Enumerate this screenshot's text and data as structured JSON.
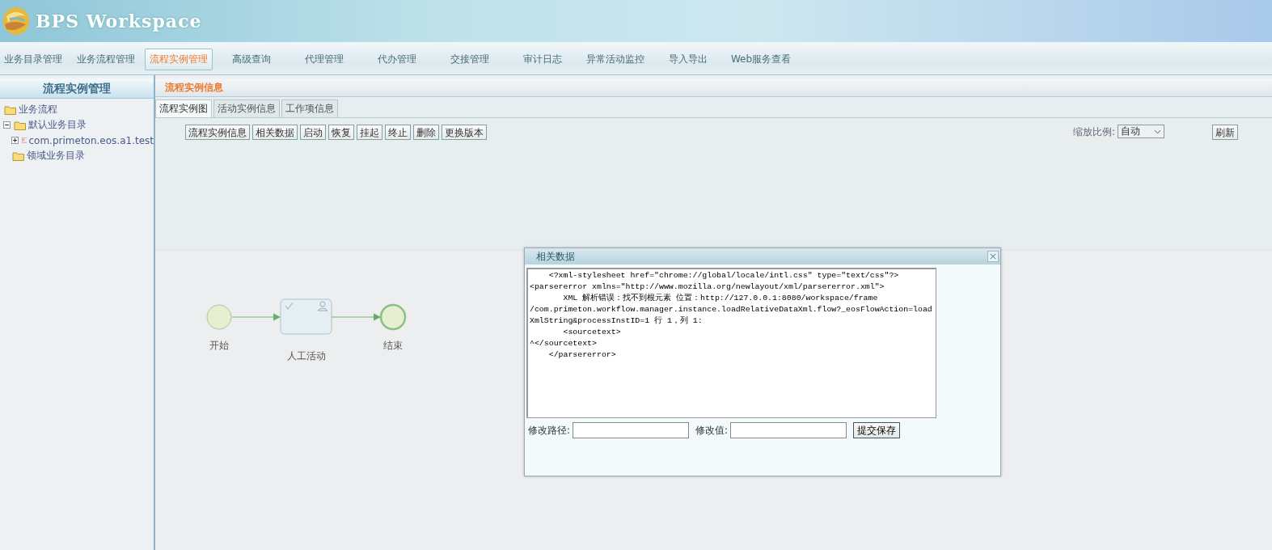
{
  "header": {
    "title": "BPS Workspace"
  },
  "nav": [
    {
      "label": "业务目录管理",
      "selected": false
    },
    {
      "label": "业务流程管理",
      "selected": false
    },
    {
      "label": "流程实例管理",
      "selected": true
    },
    {
      "label": "高级查询",
      "selected": false
    },
    {
      "label": "代理管理",
      "selected": false
    },
    {
      "label": "代办管理",
      "selected": false
    },
    {
      "label": "交接管理",
      "selected": false
    },
    {
      "label": "审计日志",
      "selected": false
    },
    {
      "label": "异常活动监控",
      "selected": false
    },
    {
      "label": "导入导出",
      "selected": false
    },
    {
      "label": "Web服务查看",
      "selected": false
    }
  ],
  "sidebar": {
    "title": "流程实例管理",
    "tree": [
      {
        "label": "业务流程",
        "kind": "folder",
        "children": [
          {
            "label": "默认业务目录",
            "kind": "folder",
            "expanded": true,
            "children": [
              {
                "label": "com.primeton.eos.a1.test",
                "kind": "process",
                "expanded": false
              }
            ]
          },
          {
            "label": "领域业务目录",
            "kind": "folder"
          }
        ]
      }
    ]
  },
  "content": {
    "title": "流程实例信息",
    "tabs": [
      {
        "label": "流程实例图",
        "selected": true
      },
      {
        "label": "活动实例信息",
        "selected": false
      },
      {
        "label": "工作项信息",
        "selected": false
      }
    ],
    "toolbar": [
      "流程实例信息",
      "相关数据",
      "启动",
      "恢复",
      "挂起",
      "终止",
      "删除",
      "更换版本"
    ],
    "zoom_label": "缩放比例:",
    "zoom_value": "自动",
    "refresh": "刷新",
    "diagram": {
      "nodes": [
        {
          "kind": "start",
          "label": "开始"
        },
        {
          "kind": "activity",
          "label": "人工活动"
        },
        {
          "kind": "end",
          "label": "结束"
        }
      ]
    }
  },
  "dialog": {
    "title": "相关数据",
    "close": "×",
    "lines": [
      "    <?xml-stylesheet href=\"chrome://global/locale/intl.css\" type=\"text/css\"?>",
      "<parsererror xmlns=\"http://www.mozilla.org/newlayout/xml/parsererror.xml\">",
      "       XML 解析错误：找不到根元素 位置：http://127.0.0.1:8080/workspace/frame",
      "/com.primeton.workflow.manager.instance.loadRelativeDataXml.flow?_eosFlowAction=load",
      "XmlString&processInstID=1 行 1，列 1:",
      "       <sourcetext>",
      "^</sourcetext>",
      "    </parsererror>"
    ],
    "fields": [
      {
        "label": "修改路径:"
      },
      {
        "label": "修改值:"
      }
    ],
    "submit": "提交保存"
  }
}
